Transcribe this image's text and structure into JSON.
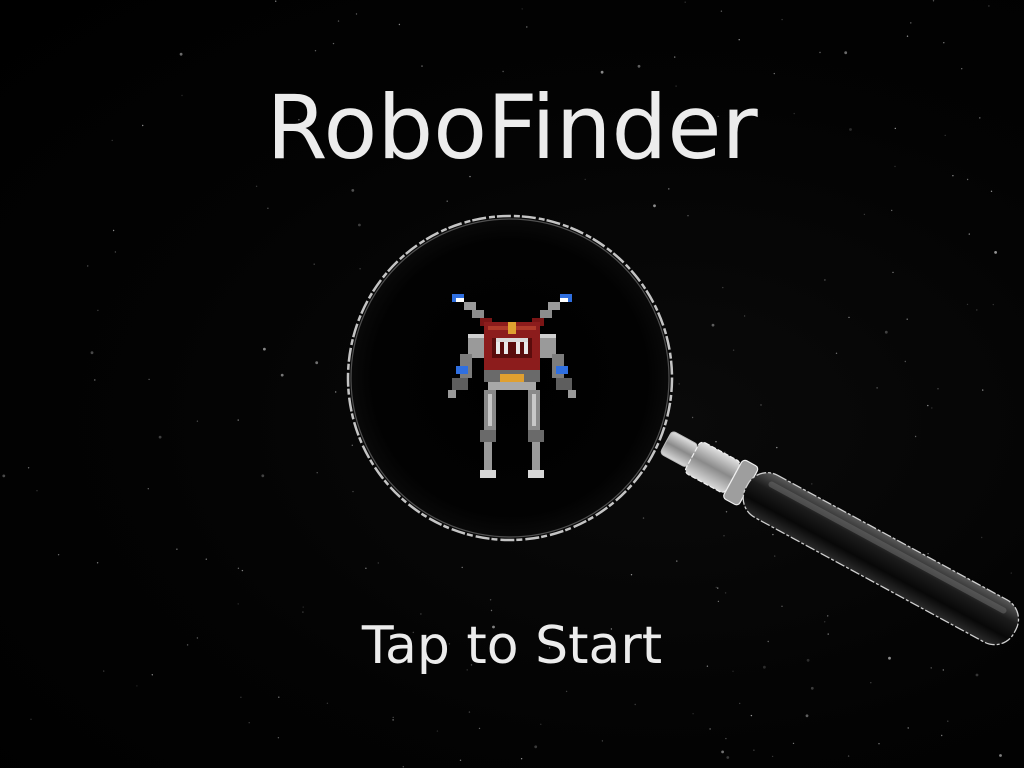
{
  "game": {
    "title": "RoboFinder",
    "start_prompt": "Tap to Start"
  },
  "icons": {
    "magnifier": "magnifying-glass-icon",
    "robot": "robot-sprite-icon"
  },
  "colors": {
    "background": "#000000",
    "text": "#ececec",
    "robot_armor": "#8c1c1c",
    "robot_metal": "#9a9a9a",
    "robot_thrusters": "#2f6fe0"
  }
}
